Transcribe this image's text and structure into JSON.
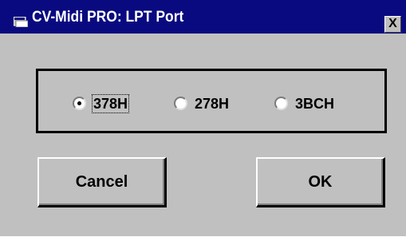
{
  "window": {
    "title": "CV-Midi PRO: LPT Port",
    "close_glyph": "X",
    "icon": "app-window-icon"
  },
  "port_options": [
    {
      "label": "378H",
      "selected": true
    },
    {
      "label": "278H",
      "selected": false
    },
    {
      "label": "3BCH",
      "selected": false
    }
  ],
  "buttons": {
    "cancel_label": "Cancel",
    "ok_label": "OK"
  },
  "colors": {
    "titlebar": "#0a0a80",
    "face": "#c0c0c0",
    "title_text": "#ffffff"
  }
}
